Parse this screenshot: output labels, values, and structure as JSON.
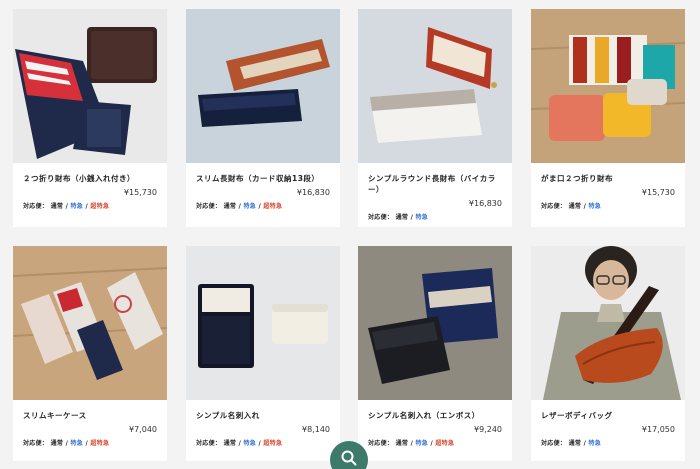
{
  "products": [
    {
      "name": "２つ折り財布（小銭入れ付き）",
      "price": "¥15,730",
      "ship_label": "対応便：",
      "ship_normal": "通常",
      "ship_tokkyu": "特急",
      "ship_cho": "超特急"
    },
    {
      "name": "スリム長財布（カード収納13段）",
      "price": "¥16,830",
      "ship_label": "対応便：",
      "ship_normal": "通常",
      "ship_tokkyu": "特急",
      "ship_cho": "超特急"
    },
    {
      "name": "シンプルラウンド長財布（バイカラー）",
      "price": "¥16,830",
      "ship_label": "対応便：",
      "ship_normal": "通常",
      "ship_tokkyu": "特急"
    },
    {
      "name": "がま口２つ折り財布",
      "price": "¥15,730",
      "ship_label": "対応便：",
      "ship_normal": "通常",
      "ship_tokkyu": "特急"
    },
    {
      "name": "スリムキーケース",
      "price": "¥7,040",
      "ship_label": "対応便：",
      "ship_normal": "通常",
      "ship_tokkyu": "特急",
      "ship_cho": "超特急"
    },
    {
      "name": "シンプル名刺入れ",
      "price": "¥8,140",
      "ship_label": "対応便：",
      "ship_normal": "通常",
      "ship_tokkyu": "特急",
      "ship_cho": "超特急"
    },
    {
      "name": "シンプル名刺入れ（エンボス）",
      "price": "¥9,240",
      "ship_label": "対応便：",
      "ship_normal": "通常",
      "ship_tokkyu": "特急",
      "ship_cho": "超特急"
    },
    {
      "name": "レザーボディバッグ",
      "price": "¥17,050",
      "ship_label": "対応便：",
      "ship_normal": "通常",
      "ship_tokkyu": "特急"
    }
  ],
  "colors": {
    "tokkyu": "#2f6fd1",
    "cho_tokkyu": "#d8442a",
    "fab": "#3d7a6a"
  },
  "icons": {
    "fab": "search-icon"
  }
}
